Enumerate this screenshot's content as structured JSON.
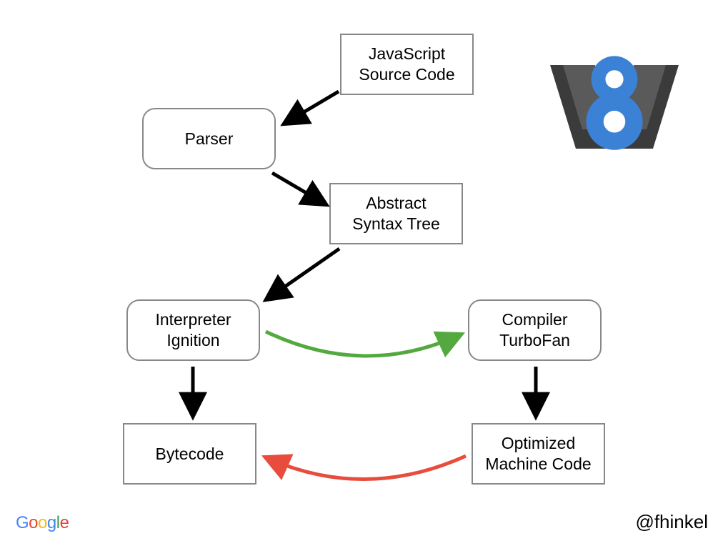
{
  "nodes": {
    "source": {
      "label": "JavaScript\nSource Code"
    },
    "parser": {
      "label": "Parser"
    },
    "ast": {
      "label": "Abstract\nSyntax Tree"
    },
    "interpreter": {
      "label": "Interpreter\nIgnition"
    },
    "compiler": {
      "label": "Compiler\nTurboFan"
    },
    "bytecode": {
      "label": "Bytecode"
    },
    "optimized": {
      "label": "Optimized\nMachine Code"
    }
  },
  "edges": [
    {
      "from": "source",
      "to": "parser",
      "color": "#000"
    },
    {
      "from": "parser",
      "to": "ast",
      "color": "#000"
    },
    {
      "from": "ast",
      "to": "interpreter",
      "color": "#000"
    },
    {
      "from": "interpreter",
      "to": "bytecode",
      "color": "#000"
    },
    {
      "from": "compiler",
      "to": "optimized",
      "color": "#000"
    },
    {
      "from": "interpreter",
      "to": "compiler",
      "color": "#53A93F",
      "curved": true
    },
    {
      "from": "optimized",
      "to": "bytecode",
      "color": "#E74C3C",
      "curved": true
    }
  ],
  "footer": {
    "handle": "@fhinkel",
    "google_letters": [
      "G",
      "o",
      "o",
      "g",
      "l",
      "e"
    ],
    "google_colors": [
      "#4285F4",
      "#EA4335",
      "#FBBC05",
      "#4285F4",
      "#34A853",
      "#EA4335"
    ]
  },
  "logo": {
    "name": "v8"
  }
}
